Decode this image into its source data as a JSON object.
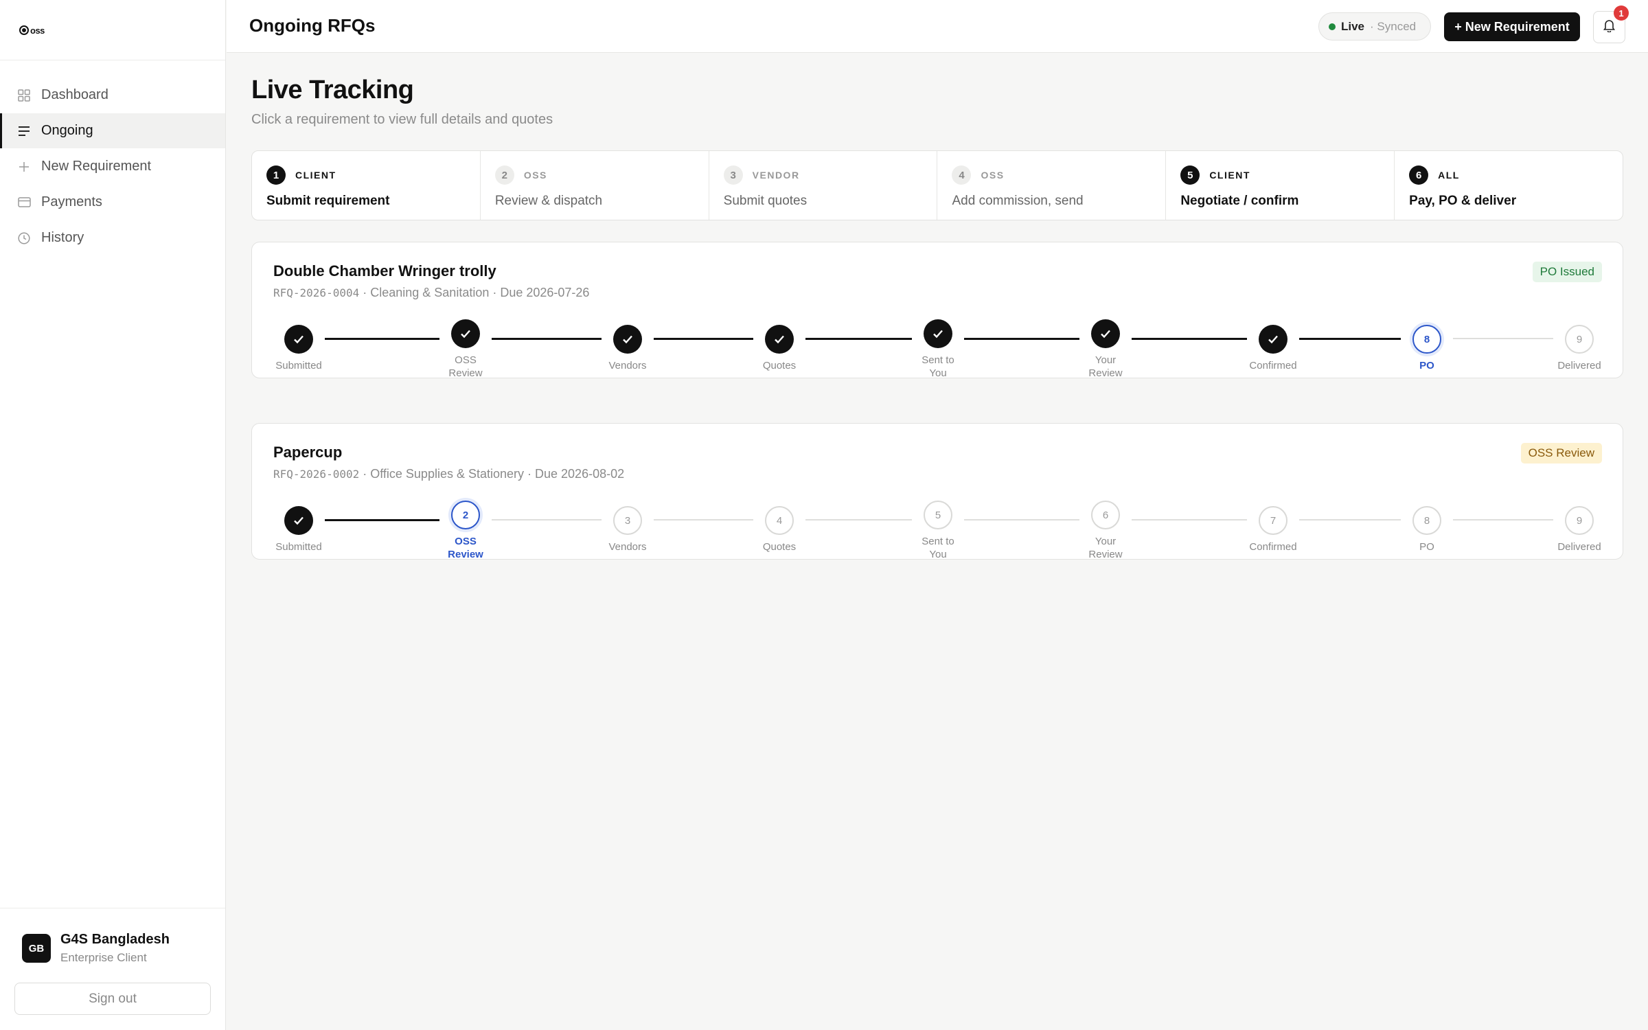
{
  "app": {
    "logo_text": "oss"
  },
  "sidebar": {
    "items": [
      {
        "label": "Dashboard",
        "icon": "grid-icon",
        "active": false
      },
      {
        "label": "Ongoing",
        "icon": "list-icon",
        "active": true
      },
      {
        "label": "New Requirement",
        "icon": "plus-icon",
        "active": false
      },
      {
        "label": "Payments",
        "icon": "card-icon",
        "active": false
      },
      {
        "label": "History",
        "icon": "clock-icon",
        "active": false
      }
    ],
    "user": {
      "initials": "GB",
      "name": "G4S Bangladesh",
      "role": "Enterprise Client"
    },
    "signout_label": "Sign out"
  },
  "topbar": {
    "title": "Ongoing RFQs",
    "status_live": "Live",
    "status_synced": "· Synced",
    "new_button_label": "+ New Requirement",
    "notification_count": "1"
  },
  "main": {
    "title": "Live Tracking",
    "subtitle": "Click a requirement to view full details and quotes",
    "process_steps": [
      {
        "num": "1",
        "role": "CLIENT",
        "label": "Submit requirement",
        "highlight": true
      },
      {
        "num": "2",
        "role": "OSS",
        "label": "Review & dispatch",
        "highlight": false
      },
      {
        "num": "3",
        "role": "VENDOR",
        "label": "Submit quotes",
        "highlight": false
      },
      {
        "num": "4",
        "role": "OSS",
        "label": "Add commission, send",
        "highlight": false
      },
      {
        "num": "5",
        "role": "CLIENT",
        "label": "Negotiate / confirm",
        "highlight": true
      },
      {
        "num": "6",
        "role": "ALL",
        "label": "Pay, PO & deliver",
        "highlight": true
      }
    ],
    "requirements": [
      {
        "title": "Double Chamber Wringer trolly",
        "rfq": "RFQ-2026-0004",
        "meta": " · Cleaning & Sanitation · Due 2026-07-26",
        "status": "PO Issued",
        "status_color": "#1f7a3a",
        "current_stage": 8,
        "stages": [
          {
            "num": "1",
            "label": "Submitted"
          },
          {
            "num": "2",
            "label": "OSS\nReview"
          },
          {
            "num": "3",
            "label": "Vendors"
          },
          {
            "num": "4",
            "label": "Quotes"
          },
          {
            "num": "5",
            "label": "Sent to\nYou"
          },
          {
            "num": "6",
            "label": "Your\nReview"
          },
          {
            "num": "7",
            "label": "Confirmed"
          },
          {
            "num": "8",
            "label": "PO"
          },
          {
            "num": "9",
            "label": "Delivered"
          }
        ]
      },
      {
        "title": "Papercup",
        "rfq": "RFQ-2026-0002",
        "meta": " · Office Supplies & Stationery · Due 2026-08-02",
        "status": "OSS Review",
        "status_color": "#8a5a0c",
        "current_stage": 2,
        "stages": [
          {
            "num": "1",
            "label": "Submitted"
          },
          {
            "num": "2",
            "label": "OSS\nReview"
          },
          {
            "num": "3",
            "label": "Vendors"
          },
          {
            "num": "4",
            "label": "Quotes"
          },
          {
            "num": "5",
            "label": "Sent to\nYou"
          },
          {
            "num": "6",
            "label": "Your\nReview"
          },
          {
            "num": "7",
            "label": "Confirmed"
          },
          {
            "num": "8",
            "label": "PO"
          },
          {
            "num": "9",
            "label": "Delivered"
          }
        ]
      }
    ]
  }
}
